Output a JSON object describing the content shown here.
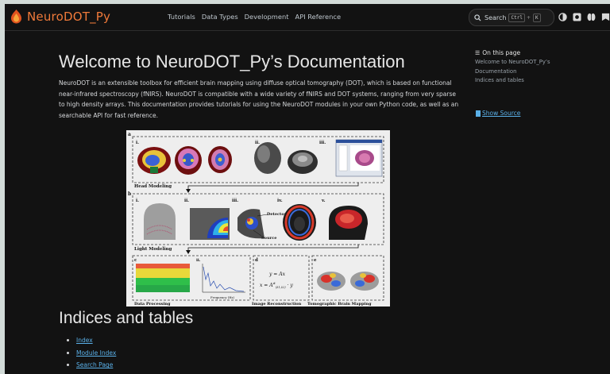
{
  "brand": {
    "name": "NeuroDOT_Py"
  },
  "nav": [
    "Tutorials",
    "Data Types",
    "Development",
    "API Reference"
  ],
  "search": {
    "label": "Search",
    "key1": "Ctrl",
    "key2": "K"
  },
  "main": {
    "title": "Welcome to NeuroDOT_Py’s Documentation",
    "intro": "NeuroDOT is an extensible toolbox for efficient brain mapping using diffuse optical tomography (DOT), which is based on functional near-infrared spectroscopy (fNIRS). NeuroDOT is compatible with a wide variety of fNIRS and DOT systems, ranging from very sparse to high density arrays. This documentation provides tutorials for using the NeuroDOT modules in your own Python code, as well as an searchable API for fast reference.",
    "indices_title": "Indices and tables",
    "links": [
      "Index",
      "Module Index",
      "Search Page"
    ]
  },
  "figure": {
    "section_a": "a",
    "section_b": "b",
    "row1_label": "Head Modeling",
    "row2_label": "Light Modeling",
    "row3_label": "Data Processing",
    "row4_label": "Image Reconstruction",
    "row5_label": "Tomographic Brain Mapping",
    "roman_i": "i.",
    "roman_ii": "ii.",
    "roman_iii": "iii.",
    "roman_iv": "iv.",
    "roman_v": "v.",
    "c_label": "c",
    "d_label": "d",
    "e_label": "e",
    "detector": "Detector",
    "source": "Source",
    "eq1": "y = Ax",
    "eq2": "x = A",
    "eq2_sup": "#",
    "eq2_sub": "(λ1,λ2)",
    "eq2_tail": " · y",
    "power_axis": "Power (a.u.)",
    "freq_axis": "Frequency (Hz)"
  },
  "toc": {
    "title": "On this page",
    "items": [
      "Welcome to NeuroDOT_Py’s",
      "Documentation",
      "Indices and tables"
    ],
    "show_source": "Show Source"
  }
}
